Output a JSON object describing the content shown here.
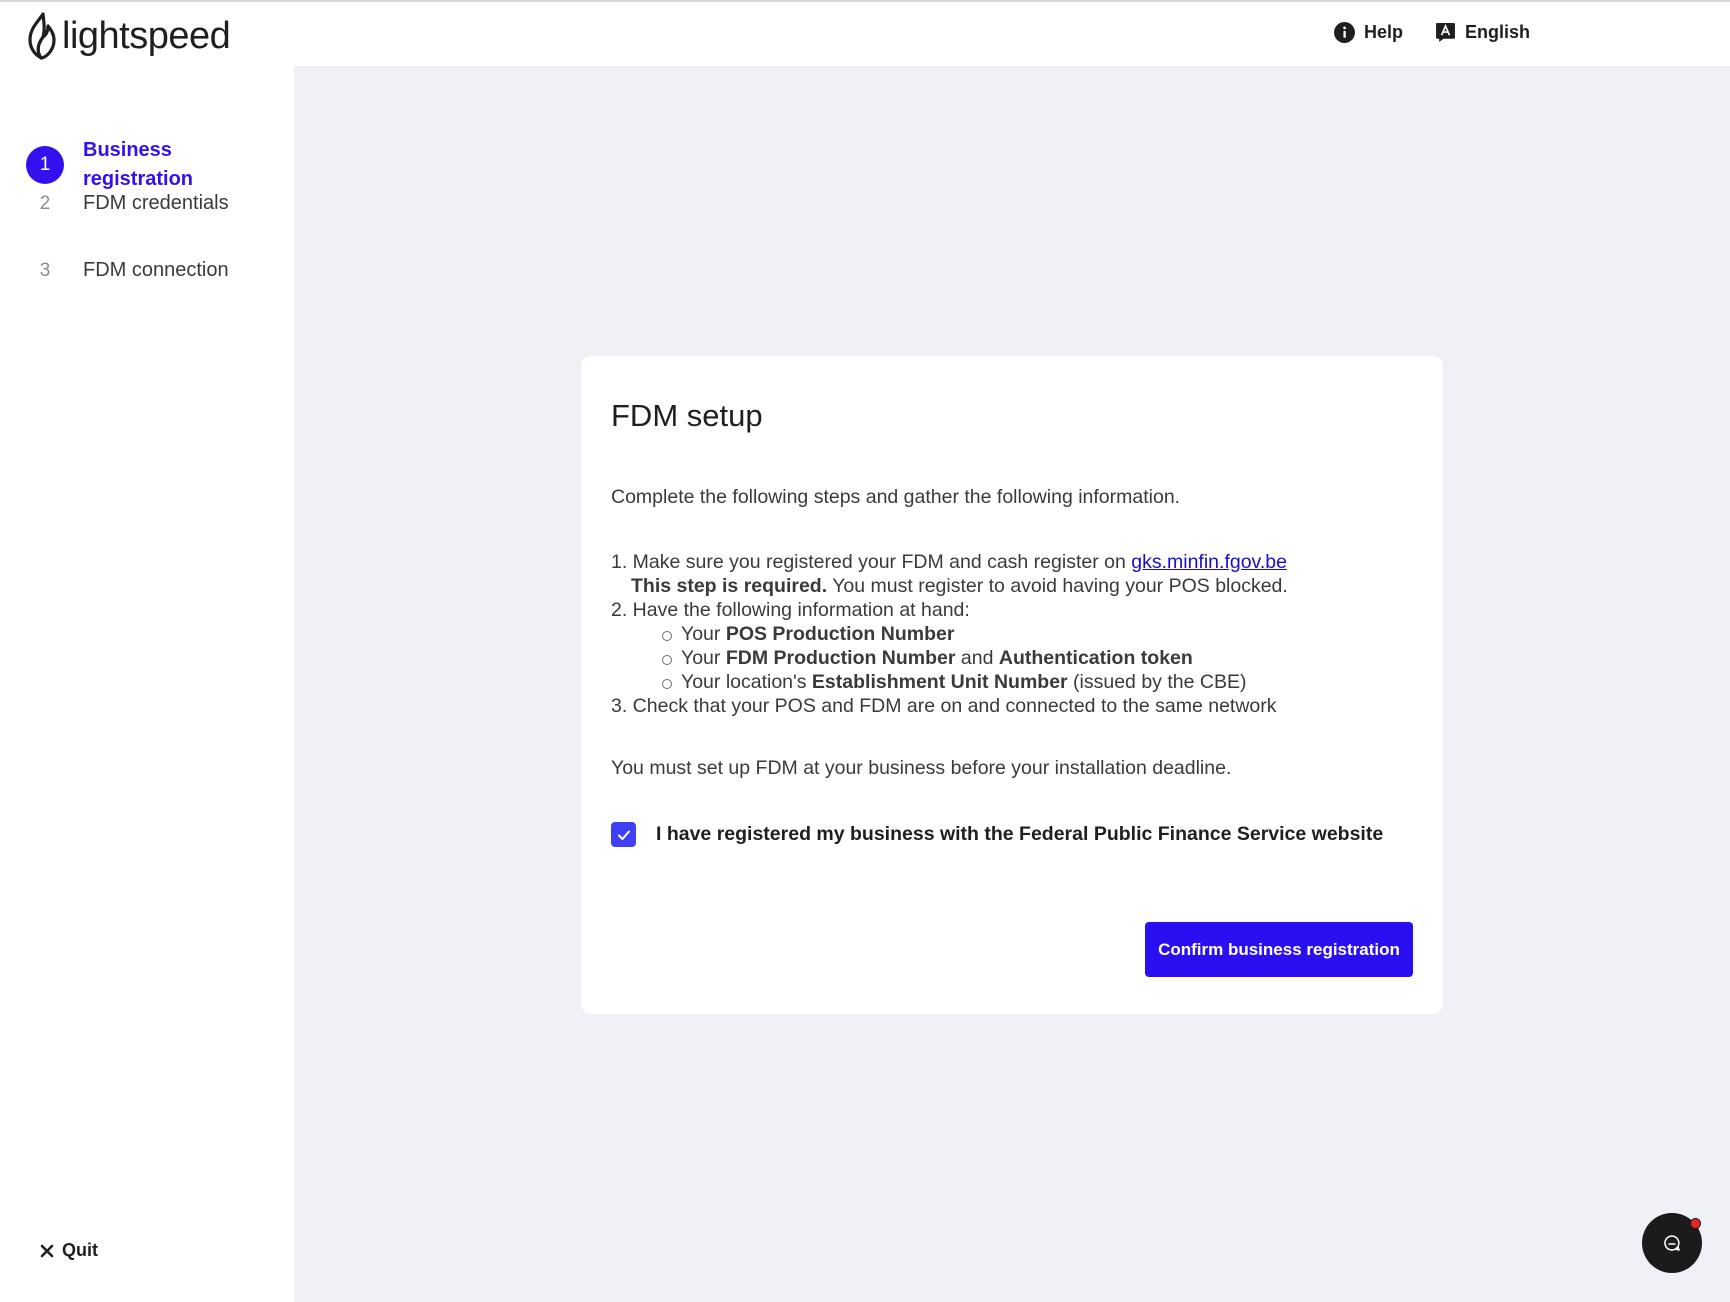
{
  "brand": {
    "name": "lightspeed"
  },
  "header": {
    "help_label": "Help",
    "help_icon": "info-icon",
    "language_label": "English",
    "language_icon": "translate-icon"
  },
  "sidebar": {
    "steps": [
      {
        "number": "1",
        "label": "Business registration",
        "active": true
      },
      {
        "number": "2",
        "label": "FDM credentials",
        "active": false
      },
      {
        "number": "3",
        "label": "FDM connection",
        "active": false
      }
    ],
    "quit_label": "Quit"
  },
  "card": {
    "title": "FDM setup",
    "intro": "Complete the following steps and gather the following information.",
    "step1_prefix": "1. Make sure you registered your FDM and cash register on ",
    "step1_link": "gks.minfin.fgov.be",
    "step1_required": "This step is required.",
    "step1_note": " You must register to avoid having your POS blocked.",
    "step2": "2. Have the following information at hand:",
    "sub1_a": "Your ",
    "sub1_b": "POS Production Number",
    "sub2_a": "Your ",
    "sub2_b": "FDM Production Number",
    "sub2_c": " and ",
    "sub2_d": "Authentication token",
    "sub3_a": "Your location's ",
    "sub3_b": "Establishment Unit Number",
    "sub3_c": " (issued by the CBE)",
    "step3": "3. Check that your POS and FDM are on and connected to the same network",
    "deadline": "You must set up FDM at your business before your installation deadline.",
    "checkbox_label": "I have registered my business with the Federal Public Finance Service website",
    "checkbox_checked": true,
    "confirm_label": "Confirm business registration"
  },
  "colors": {
    "accent": "#3311ee",
    "background": "#f0f1f6",
    "checkbox": "#3f3ff5",
    "notification": "#e8262a"
  }
}
